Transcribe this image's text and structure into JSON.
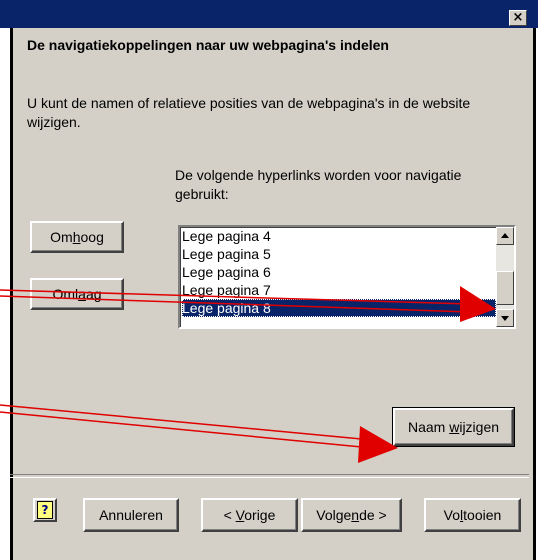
{
  "window": {
    "close_glyph": "×"
  },
  "page": {
    "heading": "De navigatiekoppelingen naar uw webpagina's indelen",
    "description": "U kunt de namen of relatieve posities van de webpagina's in de website wijzigen.",
    "list_label": "De volgende hyperlinks worden voor navigatie gebruikt:"
  },
  "buttons": {
    "up": {
      "pre": "Om",
      "accel": "h",
      "post": "oog"
    },
    "down": {
      "pre": "Oml",
      "accel": "a",
      "post": "ag"
    },
    "rename": {
      "pre": "Naam ",
      "accel": "w",
      "post": "ijzigen"
    }
  },
  "list": {
    "items": [
      "Lege pagina 4",
      "Lege pagina 5",
      "Lege pagina 6",
      "Lege pagina 7",
      "Lege pagina 8"
    ],
    "selected_index": 4
  },
  "footer": {
    "help_glyph": "?",
    "cancel": "Annuleren",
    "prev": {
      "pre": "< ",
      "accel": "V",
      "post": "orige"
    },
    "next": {
      "pre": "Volge",
      "accel": "n",
      "post": "de >"
    },
    "finish": {
      "pre": "Vo",
      "accel": "l",
      "post": "tooien"
    }
  },
  "colors": {
    "titlebar": "#0a246a",
    "dialog_face": "#d4d0c8",
    "selection": "#0a246a",
    "annotation_arrow": "#e00000"
  }
}
